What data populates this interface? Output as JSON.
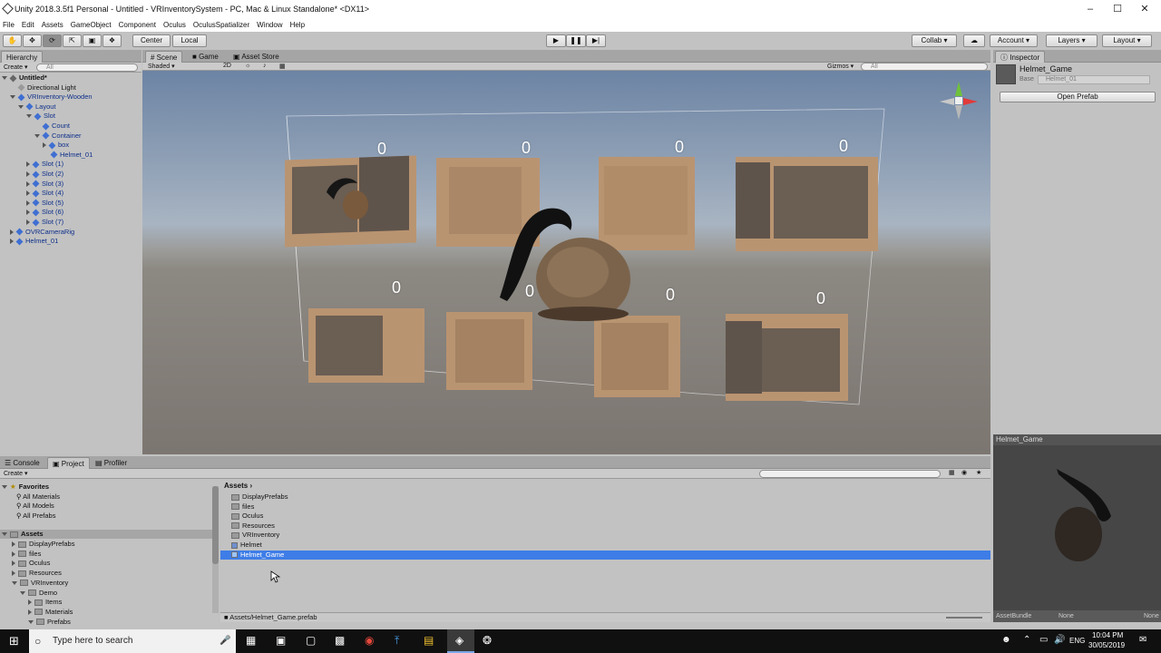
{
  "window": {
    "title": "Unity 2018.3.5f1 Personal - Untitled - VRInventorySystem - PC, Mac & Linux Standalone* <DX11>"
  },
  "menu": [
    "File",
    "Edit",
    "Assets",
    "GameObject",
    "Component",
    "Oculus",
    "OculusSpatializer",
    "Window",
    "Help"
  ],
  "toolbar": {
    "pivot": "Center",
    "space": "Local",
    "collab": "Collab",
    "account": "Account",
    "layers": "Layers",
    "layout": "Layout"
  },
  "hierarchy": {
    "tab": "Hierarchy",
    "create": "Create",
    "search_placeholder": "All",
    "rows": [
      {
        "label": "Untitled*",
        "indent": 0,
        "blue": false,
        "bold": true
      },
      {
        "label": "Directional Light",
        "indent": 1,
        "blue": false
      },
      {
        "label": "VRInventory-Wooden",
        "indent": 1,
        "blue": true
      },
      {
        "label": "Layout",
        "indent": 2,
        "blue": true
      },
      {
        "label": "Slot",
        "indent": 3,
        "blue": true
      },
      {
        "label": "Count",
        "indent": 4,
        "blue": true
      },
      {
        "label": "Container",
        "indent": 4,
        "blue": true
      },
      {
        "label": "box",
        "indent": 5,
        "blue": true
      },
      {
        "label": "Helmet_01",
        "indent": 5,
        "blue": true
      },
      {
        "label": "Slot (1)",
        "indent": 3,
        "blue": true
      },
      {
        "label": "Slot (2)",
        "indent": 3,
        "blue": true
      },
      {
        "label": "Slot (3)",
        "indent": 3,
        "blue": true
      },
      {
        "label": "Slot (4)",
        "indent": 3,
        "blue": true
      },
      {
        "label": "Slot (5)",
        "indent": 3,
        "blue": true
      },
      {
        "label": "Slot (6)",
        "indent": 3,
        "blue": true
      },
      {
        "label": "Slot (7)",
        "indent": 3,
        "blue": true
      },
      {
        "label": "OVRCameraRig",
        "indent": 1,
        "blue": true
      },
      {
        "label": "Helmet_01",
        "indent": 1,
        "blue": true
      }
    ]
  },
  "scene": {
    "tabs": [
      "Scene",
      "Game",
      "Asset Store"
    ],
    "shading": "Shaded",
    "mode2d": "2D",
    "gizmos": "Gizmos",
    "search_placeholder": "All",
    "slot_counts": [
      "0",
      "0",
      "0",
      "0",
      "0",
      "0",
      "0",
      "0"
    ]
  },
  "inspector": {
    "tab": "Inspector",
    "object_name": "Helmet_Game",
    "base_label": "Base",
    "base_value": "Helmet_01",
    "open_prefab": "Open Prefab"
  },
  "preview": {
    "title": "Helmet_Game",
    "assetbundle_label": "AssetBundle",
    "assetbundle_value": "None",
    "variant_value": "None"
  },
  "project": {
    "tabs": [
      "Console",
      "Project",
      "Profiler"
    ],
    "create": "Create",
    "favorites_label": "Favorites",
    "favorites": [
      "All Materials",
      "All Models",
      "All Prefabs"
    ],
    "assets_label": "Assets",
    "tree": [
      {
        "label": "DisplayPrefabs",
        "indent": 1
      },
      {
        "label": "files",
        "indent": 1
      },
      {
        "label": "Oculus",
        "indent": 1
      },
      {
        "label": "Resources",
        "indent": 1
      },
      {
        "label": "VRInventory",
        "indent": 1
      },
      {
        "label": "Demo",
        "indent": 2
      },
      {
        "label": "Items",
        "indent": 3
      },
      {
        "label": "Materials",
        "indent": 3
      },
      {
        "label": "Prefabs",
        "indent": 3
      }
    ],
    "breadcrumb": "Assets",
    "list": [
      "DisplayPrefabs",
      "files",
      "Oculus",
      "Resources",
      "VRInventory",
      "Helmet",
      "Helmet_Game"
    ],
    "selected_index": 6,
    "status_path": "Assets/Helmet_Game.prefab"
  },
  "taskbar": {
    "search_placeholder": "Type here to search",
    "lang": "ENG",
    "time": "10:04 PM",
    "date": "30/05/2019"
  },
  "colors": {
    "selection": "#3e7de7",
    "hierarchy_blue": "#0d2f8a",
    "taskbar": "#101010"
  }
}
